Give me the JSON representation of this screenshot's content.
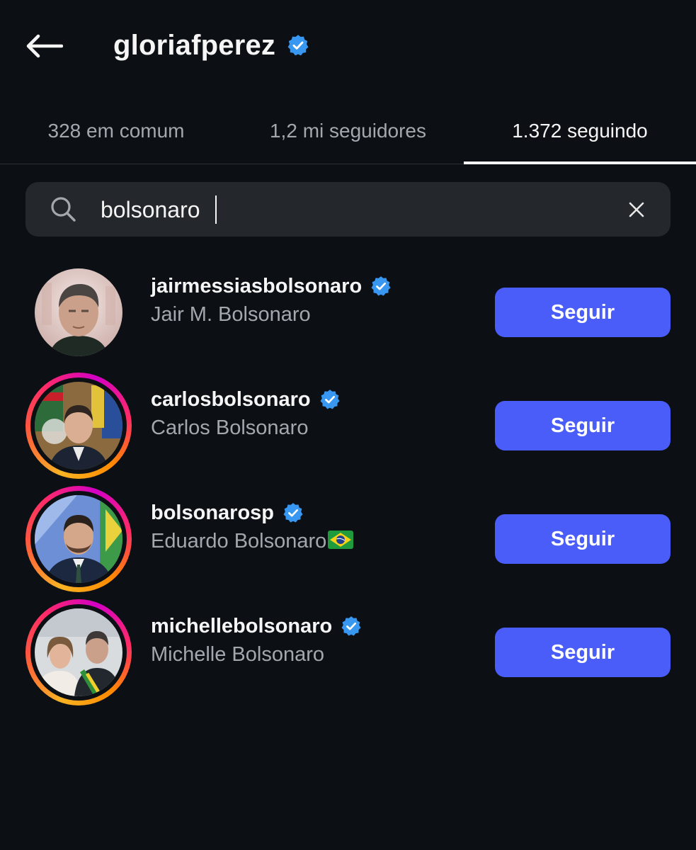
{
  "header": {
    "title": "gloriafperez",
    "back_icon": "arrow-left-icon",
    "verified_icon": "verified-badge-icon"
  },
  "tabs": [
    {
      "label": "328 em comum",
      "active": false
    },
    {
      "label": "1,2 mi seguidores",
      "active": false
    },
    {
      "label": "1.372 seguindo",
      "active": true
    }
  ],
  "search": {
    "value": "bolsonaro",
    "icon": "search-icon",
    "clear_icon": "close-icon"
  },
  "results": [
    {
      "username": "jairmessiasbolsonaro",
      "fullname": "Jair M. Bolsonaro",
      "button": "Seguir",
      "has_story": false,
      "verified": true
    },
    {
      "username": "carlosbolsonaro",
      "fullname": "Carlos Bolsonaro",
      "button": "Seguir",
      "has_story": true,
      "verified": true
    },
    {
      "username": "bolsonarosp",
      "fullname": "Eduardo Bolsonaro",
      "fullname_emoji": "brazil-flag-emoji",
      "button": "Seguir",
      "has_story": true,
      "verified": true
    },
    {
      "username": "michellebolsonaro",
      "fullname": "Michelle Bolsonaro",
      "button": "Seguir",
      "has_story": true,
      "verified": true
    }
  ],
  "colors": {
    "background": "#0c0f14",
    "accent": "#4a5df9",
    "verified": "#3897f0",
    "secondary_text": "#a4a8ae",
    "search_bg": "#24272c"
  }
}
